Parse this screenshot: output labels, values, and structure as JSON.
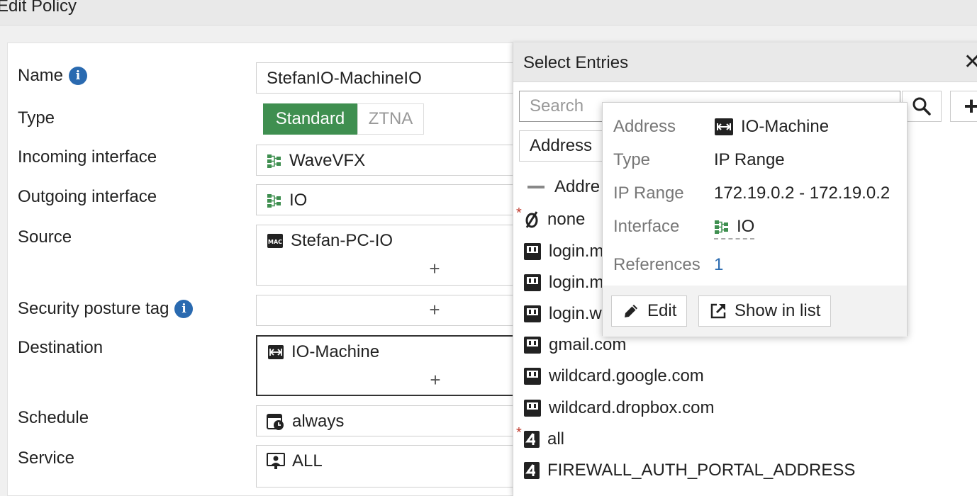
{
  "window": {
    "title": "Edit Policy"
  },
  "form": {
    "name_label": "Name",
    "name_value": "StefanIO-MachineIO",
    "type_label": "Type",
    "type_options": [
      "Standard",
      "ZTNA"
    ],
    "type_selected": "Standard",
    "incoming_label": "Incoming interface",
    "incoming_value": "WaveVFX",
    "outgoing_label": "Outgoing interface",
    "outgoing_value": "IO",
    "source_label": "Source",
    "source_value": "Stefan-PC-IO",
    "posture_label": "Security posture tag",
    "destination_label": "Destination",
    "destination_value": "IO-Machine",
    "schedule_label": "Schedule",
    "schedule_value": "always",
    "service_label": "Service",
    "service_value": "ALL",
    "add_symbol": "+"
  },
  "entries": {
    "title": "Select Entries",
    "close_symbol": "✕",
    "search_placeholder": "Search",
    "add_symbol": "+",
    "tab_label": "Address",
    "group_label": "Addre",
    "items": [
      {
        "label": "none",
        "required": true
      },
      {
        "label": "login.m"
      },
      {
        "label": "login.m"
      },
      {
        "label": "login.w"
      },
      {
        "label": "gmail.com"
      },
      {
        "label": "wildcard.google.com"
      },
      {
        "label": "wildcard.dropbox.com"
      },
      {
        "label": "all",
        "required": true
      },
      {
        "label": "FIREWALL_AUTH_PORTAL_ADDRESS"
      }
    ],
    "required_mark": "*"
  },
  "tooltip": {
    "address_key": "Address",
    "address_val": "IO-Machine",
    "type_key": "Type",
    "type_val": "IP Range",
    "range_key": "IP Range",
    "range_val": "172.19.0.2 - 172.19.0.2",
    "interface_key": "Interface",
    "interface_val": "IO",
    "references_key": "References",
    "references_val": "1",
    "edit_label": "Edit",
    "show_label": "Show in list"
  },
  "colors": {
    "accent_green": "#3f8f50",
    "info_blue": "#2a6ab0"
  }
}
